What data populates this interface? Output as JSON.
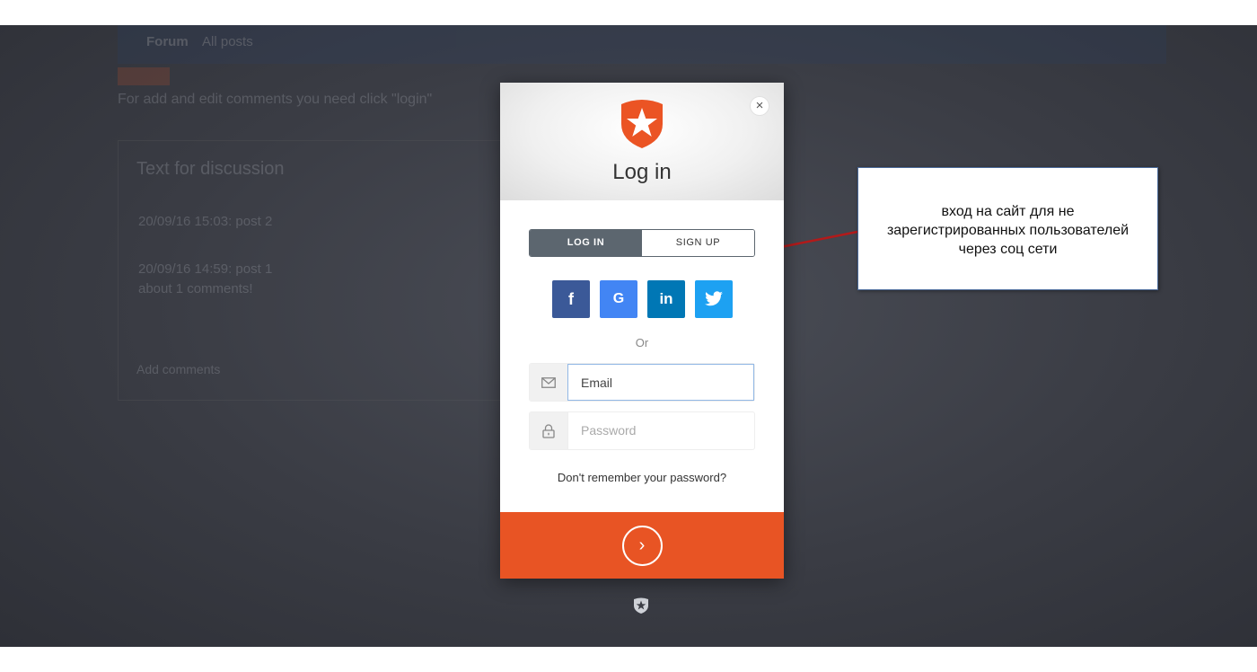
{
  "underlay": {
    "nav_brand": "Forum",
    "nav_item": "All posts",
    "note": "For add and edit comments you need click \"login\"",
    "panel_heading": "Text for discussion",
    "post_2": "20/09/16 15:03: post 2",
    "post_1": "20/09/16 14:59: post 1",
    "post_1_comments": "about 1 comments!",
    "extra_link": "Add comments"
  },
  "modal": {
    "title": "Log in",
    "close_glyph": "×",
    "tabs": [
      {
        "label": "LOG IN",
        "active": true
      },
      {
        "label": "SIGN UP",
        "active": false
      }
    ],
    "socials": [
      {
        "glyph": "f",
        "icon": "facebook-icon",
        "color": "#3b5998"
      },
      {
        "glyph": "G",
        "icon": "google-icon",
        "color": "#4285f4"
      },
      {
        "glyph": "in",
        "icon": "linkedin-icon",
        "color": "#0077b5"
      },
      {
        "glyph": "",
        "icon": "twitter-icon",
        "color": "#1da1f2"
      }
    ],
    "or_text": "Or",
    "email": {
      "value": "Email",
      "icon": "envelope-icon"
    },
    "password": {
      "placeholder": "Password",
      "icon": "lock-icon"
    },
    "forgot": "Don't remember your password?",
    "submit_glyph": "›",
    "accent_color": "#e85424"
  },
  "callout": {
    "lines": [
      "вход  на сайт для не",
      "зарегистрированных пользователей",
      "через соц сети"
    ]
  }
}
